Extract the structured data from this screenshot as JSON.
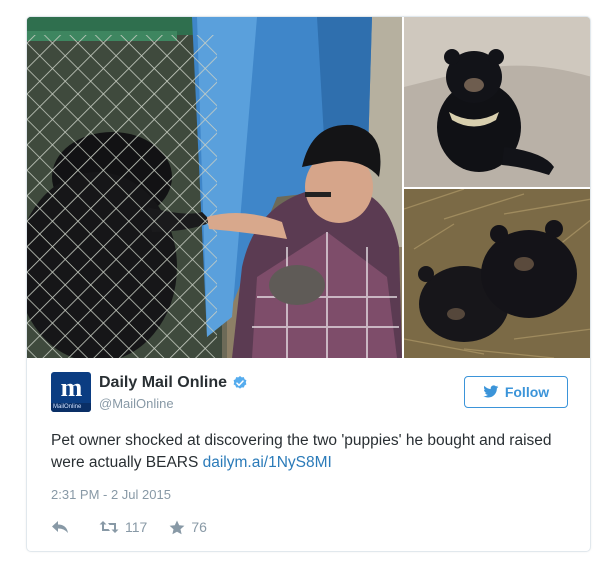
{
  "tweet": {
    "author": {
      "display_name": "Daily Mail Online",
      "handle": "@MailOnline",
      "avatar_glyph": "m",
      "avatar_strip": "MailOnline",
      "verified": true,
      "verified_icon": "verified-badge-icon"
    },
    "follow_label": "Follow",
    "text": "Pet owner shocked at discovering the two 'puppies' he bought and raised were actually BEARS ",
    "link": "dailym.ai/1NyS8MI",
    "timestamp": "2:31 PM - 2 Jul 2015",
    "actions": {
      "reply_icon": "reply-icon",
      "retweet_icon": "retweet-icon",
      "retweet_count": "117",
      "favorite_icon": "star-icon",
      "favorite_count": "76"
    }
  },
  "colors": {
    "accent": "#3b94d9",
    "link": "#2b7bb9",
    "muted": "#8899a6",
    "text": "#292f33",
    "border": "#e1e8ed",
    "avatar": "#0b3d82"
  }
}
